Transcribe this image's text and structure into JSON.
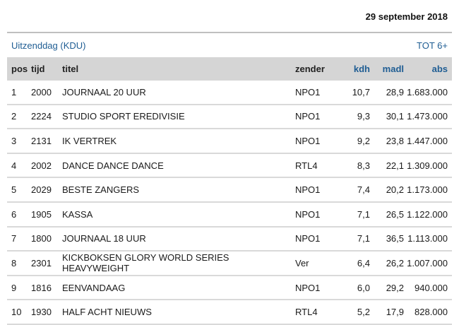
{
  "header": {
    "date": "29 september 2018"
  },
  "subheader": {
    "left": "Uitzenddag (KDU)",
    "right": "TOT 6+"
  },
  "columns": {
    "pos": "pos",
    "tijd": "tijd",
    "titel": "titel",
    "zender": "zender",
    "kdh": "kdh",
    "madl": "madl",
    "abs": "abs"
  },
  "rows": [
    {
      "pos": "1",
      "tijd": "2000",
      "titel": "JOURNAAL 20 UUR",
      "zender": "NPO1",
      "kdh": "10,7",
      "madl": "28,9",
      "abs": "1.683.000"
    },
    {
      "pos": "2",
      "tijd": "2224",
      "titel": "STUDIO SPORT EREDIVISIE",
      "zender": "NPO1",
      "kdh": "9,3",
      "madl": "30,1",
      "abs": "1.473.000"
    },
    {
      "pos": "3",
      "tijd": "2131",
      "titel": "IK VERTREK",
      "zender": "NPO1",
      "kdh": "9,2",
      "madl": "23,8",
      "abs": "1.447.000"
    },
    {
      "pos": "4",
      "tijd": "2002",
      "titel": "DANCE DANCE DANCE",
      "zender": "RTL4",
      "kdh": "8,3",
      "madl": "22,1",
      "abs": "1.309.000"
    },
    {
      "pos": "5",
      "tijd": "2029",
      "titel": "BESTE ZANGERS",
      "zender": "NPO1",
      "kdh": "7,4",
      "madl": "20,2",
      "abs": "1.173.000"
    },
    {
      "pos": "6",
      "tijd": "1905",
      "titel": "KASSA",
      "zender": "NPO1",
      "kdh": "7,1",
      "madl": "26,5",
      "abs": "1.122.000"
    },
    {
      "pos": "7",
      "tijd": "1800",
      "titel": "JOURNAAL 18 UUR",
      "zender": "NPO1",
      "kdh": "7,1",
      "madl": "36,5",
      "abs": "1.113.000"
    },
    {
      "pos": "8",
      "tijd": "2301",
      "titel": "KICKBOKSEN GLORY WORLD SERIES HEAVYWEIGHT",
      "zender": "Ver",
      "kdh": "6,4",
      "madl": "26,2",
      "abs": "1.007.000"
    },
    {
      "pos": "9",
      "tijd": "1816",
      "titel": "EENVANDAAG",
      "zender": "NPO1",
      "kdh": "6,0",
      "madl": "29,2",
      "abs": "940.000"
    },
    {
      "pos": "10",
      "tijd": "1930",
      "titel": "HALF ACHT NIEUWS",
      "zender": "RTL4",
      "kdh": "5,2",
      "madl": "17,9",
      "abs": "828.000"
    }
  ]
}
